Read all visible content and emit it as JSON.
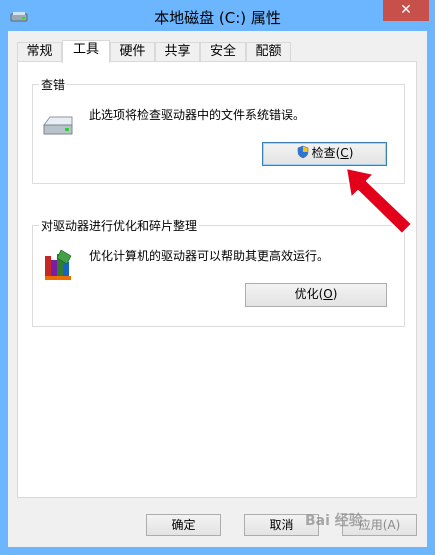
{
  "window": {
    "title": "本地磁盘 (C:) 属性",
    "close_glyph": "✕"
  },
  "tabs": [
    {
      "label": "常规"
    },
    {
      "label": "工具"
    },
    {
      "label": "硬件"
    },
    {
      "label": "共享"
    },
    {
      "label": "安全"
    },
    {
      "label": "配额"
    }
  ],
  "active_tab": "工具",
  "check_group": {
    "title": "查错",
    "description": "此选项将检查驱动器中的文件系统错误。",
    "button_prefix": "检查(",
    "button_key": "C",
    "button_suffix": ")"
  },
  "optimize_group": {
    "title": "对驱动器进行优化和碎片整理",
    "description": "优化计算机的驱动器可以帮助其更高效运行。",
    "button_prefix": "优化(",
    "button_key": "O",
    "button_suffix": ")"
  },
  "footer": {
    "ok_label": "确定",
    "cancel_label": "取消",
    "apply_label": "应用(A)"
  },
  "watermark": "Bai 经验",
  "colors": {
    "frame": "#6bb6ff",
    "close_button": "#c7504a",
    "arrow": "#e3001b"
  }
}
